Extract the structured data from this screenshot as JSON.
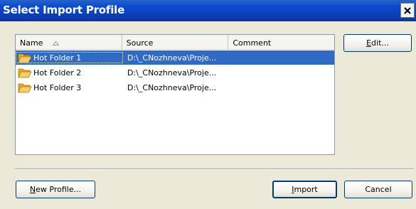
{
  "window": {
    "title": "Select Import Profile"
  },
  "columns": [
    {
      "label": "Name"
    },
    {
      "label": "Source"
    },
    {
      "label": "Comment"
    }
  ],
  "rows": [
    {
      "name": "Hot Folder 1",
      "source": "D:\\_CNozhneva\\Proje...",
      "comment": "",
      "selected": true
    },
    {
      "name": "Hot Folder 2",
      "source": "D:\\_CNozhneva\\Proje...",
      "comment": "",
      "selected": false
    },
    {
      "name": "Hot Folder 3",
      "source": "D:\\_CNozhneva\\Proje...",
      "comment": "",
      "selected": false
    }
  ],
  "buttons": {
    "edit": {
      "mnemonic": "E",
      "rest": "dit..."
    },
    "new_profile": {
      "mnemonic": "N",
      "rest": "ew Profile..."
    },
    "import": {
      "mnemonic": "I",
      "rest": "mport"
    },
    "cancel": {
      "label": "Cancel"
    }
  },
  "colors": {
    "selection": "#316ac5",
    "titlebar": "#0a4bd0",
    "folder": "#f3c34a"
  }
}
